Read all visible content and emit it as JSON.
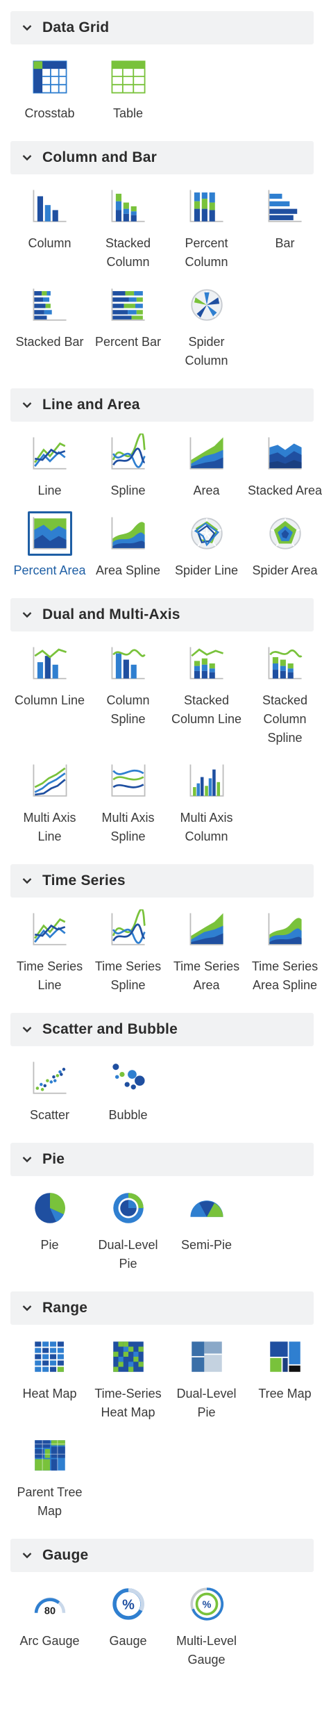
{
  "colors": {
    "dark_blue": "#1f4fa0",
    "blue": "#2f7fd0",
    "green": "#79c23b",
    "axis": "#bdbdbd",
    "header_bg": "#f1f2f3",
    "selected": "#1f5fa5"
  },
  "sections": [
    {
      "title": "Data Grid",
      "items": [
        {
          "label": "Crosstab",
          "icon": "crosstab-icon"
        },
        {
          "label": "Table",
          "icon": "table-icon"
        }
      ]
    },
    {
      "title": "Column and Bar",
      "items": [
        {
          "label": "Column",
          "icon": "column-chart-icon"
        },
        {
          "label": "Stacked Column",
          "icon": "stacked-column-icon"
        },
        {
          "label": "Percent Column",
          "icon": "percent-column-icon"
        },
        {
          "label": "Bar",
          "icon": "bar-chart-icon"
        },
        {
          "label": "Stacked Bar",
          "icon": "stacked-bar-icon"
        },
        {
          "label": "Percent Bar",
          "icon": "percent-bar-icon"
        },
        {
          "label": "Spider Column",
          "icon": "spider-column-icon"
        }
      ]
    },
    {
      "title": "Line and Area",
      "items": [
        {
          "label": "Line",
          "icon": "line-chart-icon"
        },
        {
          "label": "Spline",
          "icon": "spline-chart-icon"
        },
        {
          "label": "Area",
          "icon": "area-chart-icon"
        },
        {
          "label": "Stacked Area",
          "icon": "stacked-area-icon"
        },
        {
          "label": "Percent Area",
          "icon": "percent-area-icon",
          "selected": true
        },
        {
          "label": "Area Spline",
          "icon": "area-spline-icon"
        },
        {
          "label": "Spider Line",
          "icon": "spider-line-icon"
        },
        {
          "label": "Spider Area",
          "icon": "spider-area-icon"
        }
      ]
    },
    {
      "title": "Dual and Multi-Axis",
      "items": [
        {
          "label": "Column Line",
          "icon": "column-line-icon"
        },
        {
          "label": "Column Spline",
          "icon": "column-spline-icon"
        },
        {
          "label": "Stacked Column Line",
          "icon": "stacked-column-line-icon"
        },
        {
          "label": "Stacked Column Spline",
          "icon": "stacked-column-spline-icon"
        },
        {
          "label": "Multi Axis Line",
          "icon": "multi-axis-line-icon"
        },
        {
          "label": "Multi Axis Spline",
          "icon": "multi-axis-spline-icon"
        },
        {
          "label": "Multi Axis Column",
          "icon": "multi-axis-column-icon"
        }
      ]
    },
    {
      "title": "Time Series",
      "items": [
        {
          "label": "Time Series Line",
          "icon": "time-series-line-icon"
        },
        {
          "label": "Time Series Spline",
          "icon": "time-series-spline-icon"
        },
        {
          "label": "Time Series Area",
          "icon": "time-series-area-icon"
        },
        {
          "label": "Time Series Area Spline",
          "icon": "time-series-area-spline-icon"
        }
      ]
    },
    {
      "title": "Scatter and Bubble",
      "items": [
        {
          "label": "Scatter",
          "icon": "scatter-chart-icon"
        },
        {
          "label": "Bubble",
          "icon": "bubble-chart-icon"
        }
      ]
    },
    {
      "title": "Pie",
      "items": [
        {
          "label": "Pie",
          "icon": "pie-chart-icon"
        },
        {
          "label": "Dual-Level Pie",
          "icon": "dual-level-pie-icon"
        },
        {
          "label": "Semi-Pie",
          "icon": "semi-pie-icon"
        }
      ]
    },
    {
      "title": "Range",
      "items": [
        {
          "label": "Heat Map",
          "icon": "heat-map-icon"
        },
        {
          "label": "Time-Series Heat Map",
          "icon": "time-series-heat-map-icon"
        },
        {
          "label": "Dual-Level Pie",
          "icon": "range-dual-level-pie-icon"
        },
        {
          "label": "Tree Map",
          "icon": "tree-map-icon"
        },
        {
          "label": "Parent Tree Map",
          "icon": "parent-tree-map-icon"
        }
      ]
    },
    {
      "title": "Gauge",
      "items": [
        {
          "label": "Arc Gauge",
          "icon": "arc-gauge-icon",
          "glyph": "80"
        },
        {
          "label": "Gauge",
          "icon": "gauge-icon",
          "glyph": "%"
        },
        {
          "label": "Multi-Level Gauge",
          "icon": "multi-level-gauge-icon",
          "glyph": "%"
        }
      ]
    }
  ]
}
